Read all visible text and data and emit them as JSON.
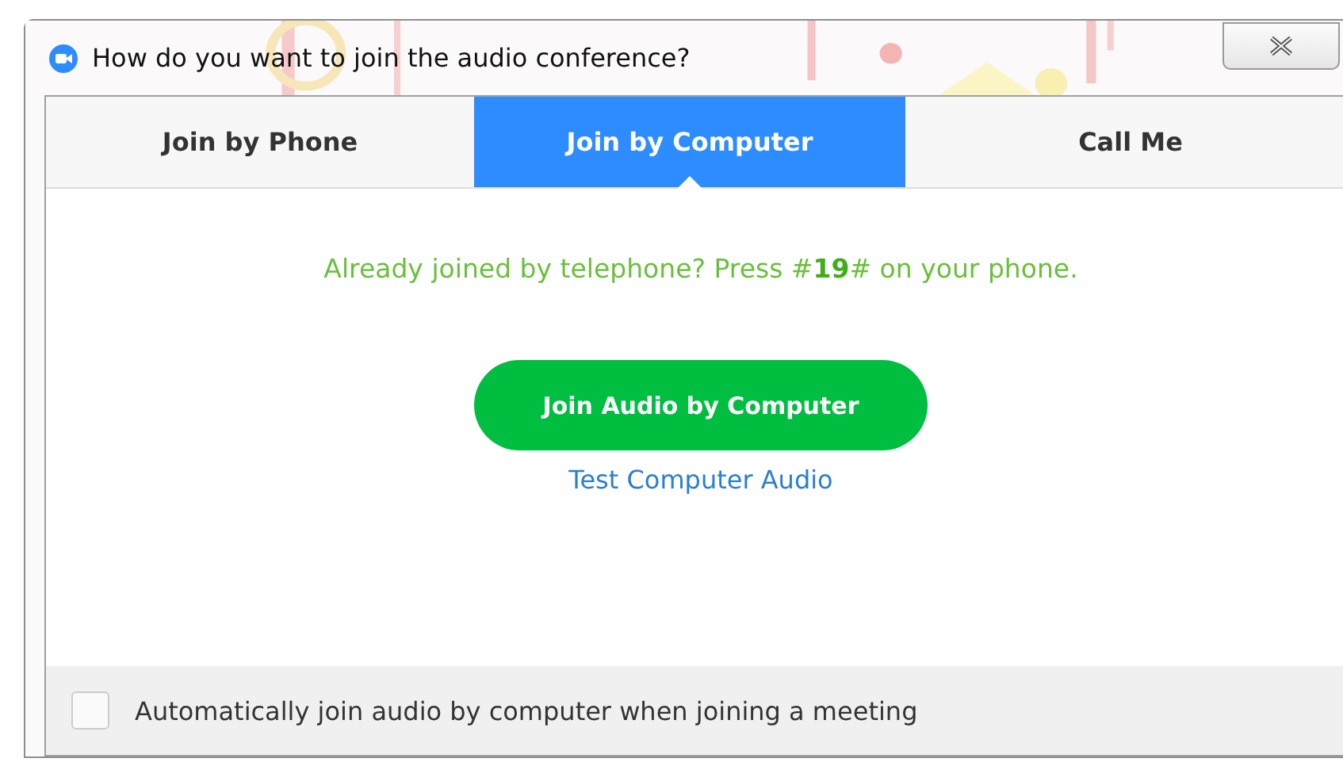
{
  "window": {
    "title": "How do you want to join the audio conference?"
  },
  "tabs": [
    {
      "label": "Join by Phone",
      "selected": false
    },
    {
      "label": "Join by Computer",
      "selected": true
    },
    {
      "label": "Call Me",
      "selected": false
    }
  ],
  "message": "Already joined by telephone? Press #**19**# on your phone.",
  "primary_button": "Join Audio by Computer",
  "link": "Test Computer Audio",
  "auto_join": {
    "label": "Automatically join audio by computer when joining a meeting",
    "checked": false
  }
}
